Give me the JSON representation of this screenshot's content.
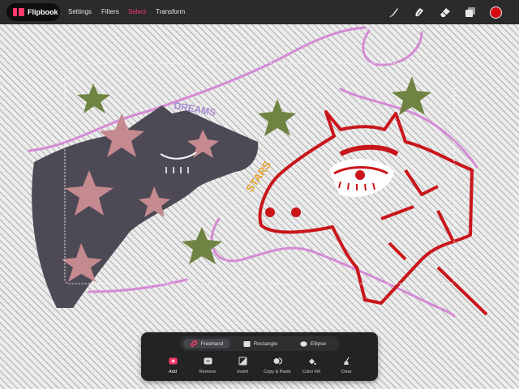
{
  "app": {
    "name": "Flipbook"
  },
  "menu": [
    {
      "label": "Settings",
      "active": false
    },
    {
      "label": "Filters",
      "active": false
    },
    {
      "label": "Select",
      "active": true
    },
    {
      "label": "Transform",
      "active": false
    }
  ],
  "tools": [
    {
      "icon": "brush-icon"
    },
    {
      "icon": "smudge-icon"
    },
    {
      "icon": "eraser-icon"
    },
    {
      "icon": "layers-icon"
    }
  ],
  "current_color": "#d40b10",
  "accent": "#ff3a6a",
  "artwork": {
    "text_dreams": "DREAMS",
    "text_stars": "STARS"
  },
  "selection_modes": [
    {
      "label": "Freehand",
      "icon": "lasso-icon",
      "active": true
    },
    {
      "label": "Rectangle",
      "icon": "rectangle-icon",
      "active": false
    },
    {
      "label": "Ellipse",
      "icon": "ellipse-icon",
      "active": false
    }
  ],
  "selection_actions": [
    {
      "label": "Add",
      "icon": "add-selection-icon",
      "active": true
    },
    {
      "label": "Remove",
      "icon": "remove-selection-icon",
      "active": false
    },
    {
      "label": "Invert",
      "icon": "invert-icon",
      "active": false
    },
    {
      "label": "Copy & Paste",
      "icon": "copy-paste-icon",
      "active": false
    },
    {
      "label": "Color Fill",
      "icon": "color-fill-icon",
      "active": false
    },
    {
      "label": "Clear",
      "icon": "clear-icon",
      "active": false
    }
  ]
}
